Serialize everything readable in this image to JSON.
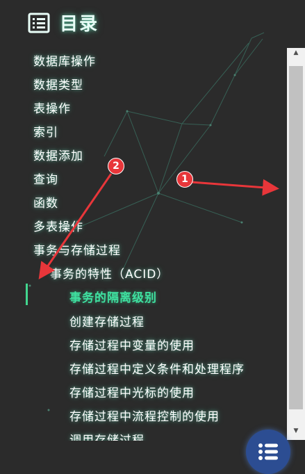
{
  "toc": {
    "title": "目录",
    "items": [
      {
        "label": "数据库操作"
      },
      {
        "label": "数据类型"
      },
      {
        "label": "表操作"
      },
      {
        "label": "索引"
      },
      {
        "label": "数据添加"
      },
      {
        "label": "查询"
      },
      {
        "label": "函数"
      },
      {
        "label": "多表操作"
      },
      {
        "label": "事务与存储过程"
      },
      {
        "label": "事务的特性（ACID）"
      },
      {
        "label": "事务的隔离级别"
      },
      {
        "label": "创建存储过程"
      },
      {
        "label": "存储过程中变量的使用"
      },
      {
        "label": "存储过程中定义条件和处理程序"
      },
      {
        "label": "存储过程中光标的使用"
      },
      {
        "label": "存储过程中流程控制的使用"
      },
      {
        "label": "调用存储过程"
      }
    ],
    "active_item": "事务的隔离级别"
  },
  "annotations": [
    {
      "label": "1"
    },
    {
      "label": "2"
    }
  ],
  "colors": {
    "background": "#2b2b2b",
    "text": "#ffffff",
    "active": "#3fe0a0",
    "annotation": "#e8363a",
    "fab": "#2c4d92"
  },
  "icons": {
    "header": "list-icon",
    "fab": "list-icon"
  }
}
